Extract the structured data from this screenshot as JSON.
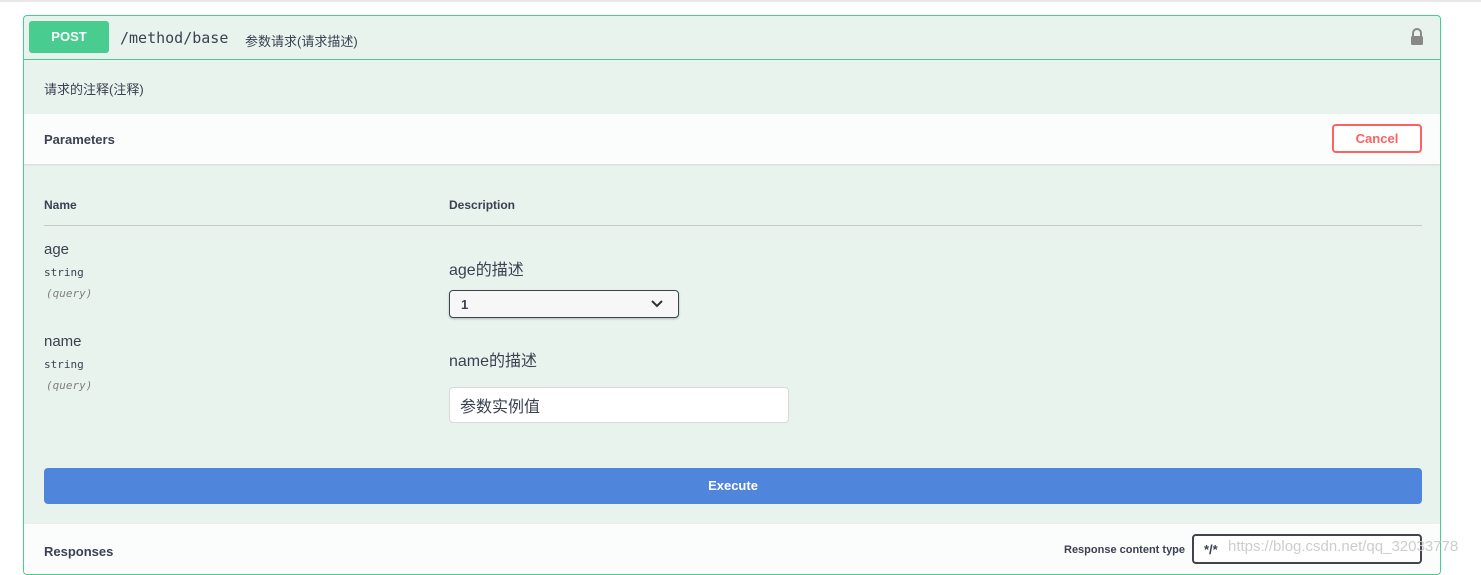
{
  "operation": {
    "method": "POST",
    "path": "/method/base",
    "summary": "参数请求(请求描述)",
    "description": "请求的注释(注释)"
  },
  "parameters_section": {
    "title": "Parameters",
    "cancel_label": "Cancel",
    "columns": {
      "name": "Name",
      "description": "Description"
    },
    "params": [
      {
        "name": "age",
        "type": "string",
        "in": "(query)",
        "description": "age的描述",
        "selected_value": "1"
      },
      {
        "name": "name",
        "type": "string",
        "in": "(query)",
        "description": "name的描述",
        "input_value": "参数实例值"
      }
    ],
    "execute_label": "Execute"
  },
  "responses_section": {
    "title": "Responses",
    "content_type_label": "Response content type",
    "content_type_value": "*/*"
  },
  "watermark": "https://blog.csdn.net/qq_32033778",
  "colors": {
    "method_post": "#49cc90",
    "execute": "#4f85db",
    "cancel": "#ff6060",
    "block_bg": "#e8f3ee"
  },
  "icons": {
    "lock": "lock-icon",
    "chevron": "chevron-down-icon"
  }
}
